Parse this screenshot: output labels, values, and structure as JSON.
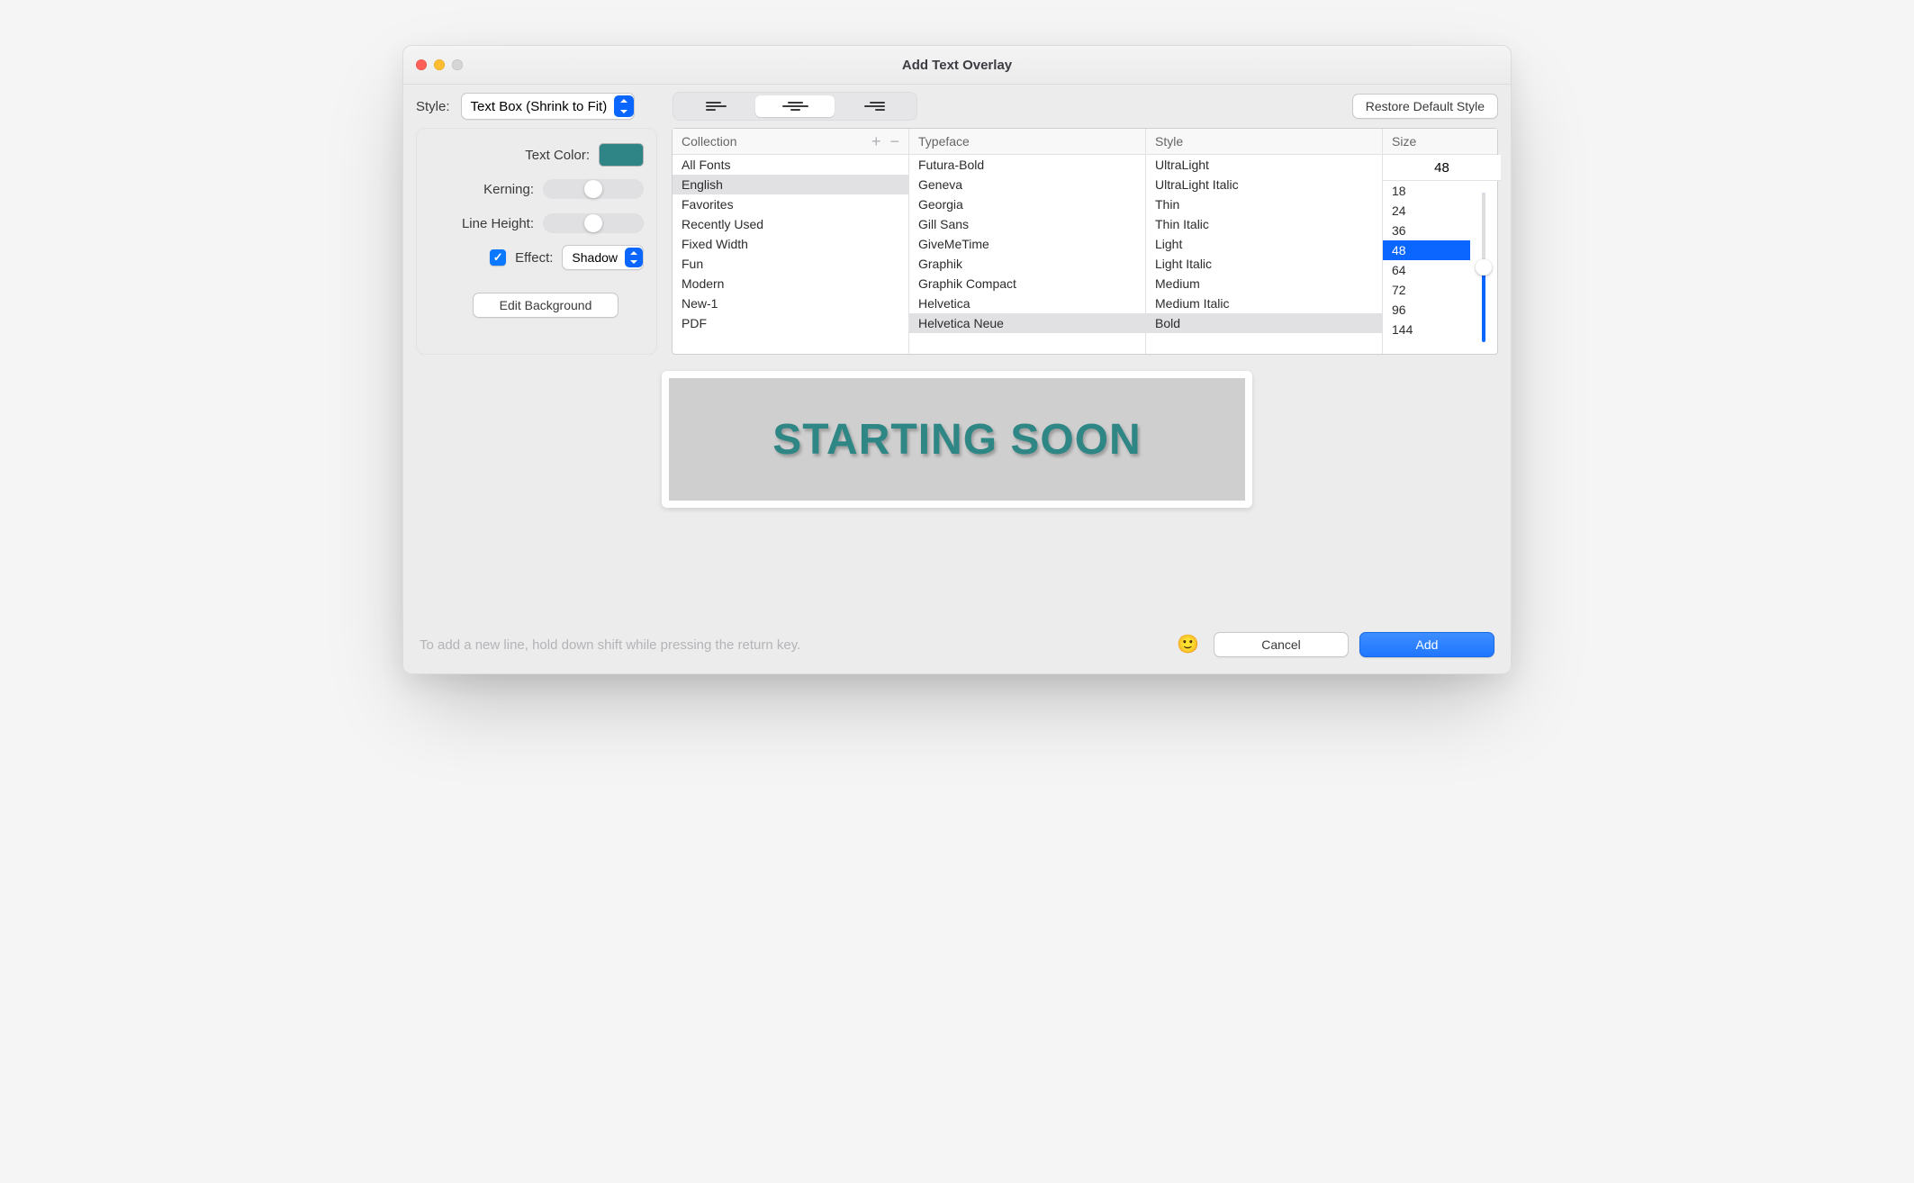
{
  "window": {
    "title": "Add Text Overlay"
  },
  "toolbar": {
    "style_label": "Style:",
    "style_value": "Text Box (Shrink to Fit)",
    "alignment_selected": "center",
    "restore_label": "Restore Default Style"
  },
  "sidepanel": {
    "text_color_label": "Text Color:",
    "text_color_value": "#2f8585",
    "kerning_label": "Kerning:",
    "kerning_value": 0.5,
    "line_height_label": "Line Height:",
    "line_height_value": 0.5,
    "effect_checked": true,
    "effect_label": "Effect:",
    "effect_value": "Shadow",
    "edit_background_label": "Edit Background"
  },
  "fontpanel": {
    "collection_header": "Collection",
    "typeface_header": "Typeface",
    "style_header": "Style",
    "size_header": "Size",
    "collections": [
      "All Fonts",
      "English",
      "Favorites",
      "Recently Used",
      "Fixed Width",
      "Fun",
      "Modern",
      "New-1",
      "PDF"
    ],
    "collection_selected": "English",
    "typefaces": [
      "Futura-Bold",
      "Geneva",
      "Georgia",
      "Gill Sans",
      "GiveMeTime",
      "Graphik",
      "Graphik Compact",
      "Helvetica",
      "Helvetica Neue"
    ],
    "typeface_selected": "Helvetica Neue",
    "styles": [
      "UltraLight",
      "UltraLight Italic",
      "Thin",
      "Thin Italic",
      "Light",
      "Light Italic",
      "Medium",
      "Medium Italic",
      "Bold"
    ],
    "style_selected": "Bold",
    "size_value": "48",
    "sizes": [
      "18",
      "24",
      "36",
      "48",
      "64",
      "72",
      "96",
      "144"
    ],
    "size_selected": "48"
  },
  "preview": {
    "text": "STARTING SOON"
  },
  "footer": {
    "hint": "To add a new line, hold down shift while pressing the return key.",
    "emoji_button": "🙂",
    "cancel": "Cancel",
    "add": "Add"
  }
}
